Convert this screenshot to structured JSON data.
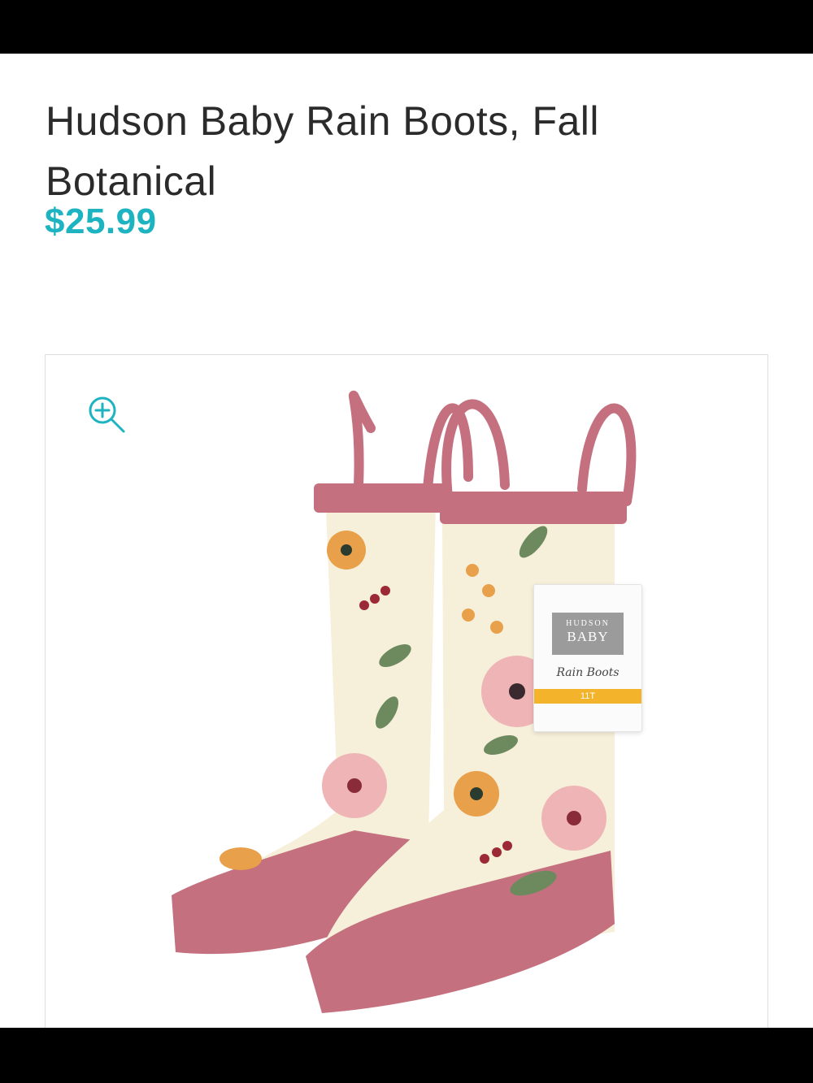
{
  "product": {
    "title": "Hudson Baby Rain Boots, Fall Botanical",
    "price": "$25.99"
  },
  "gallery": {
    "zoom_icon": "zoom-in-icon",
    "image_subject": "rain-boots-floral",
    "tag": {
      "brand_line1": "HUDSON",
      "brand_line2": "BABY",
      "product_name": "Rain Boots",
      "size": "11T"
    }
  },
  "colors": {
    "price": "#1db3c1",
    "zoom_icon": "#1db3c1",
    "boot_trim": "#c5707f",
    "boot_body": "#f6efd9"
  }
}
